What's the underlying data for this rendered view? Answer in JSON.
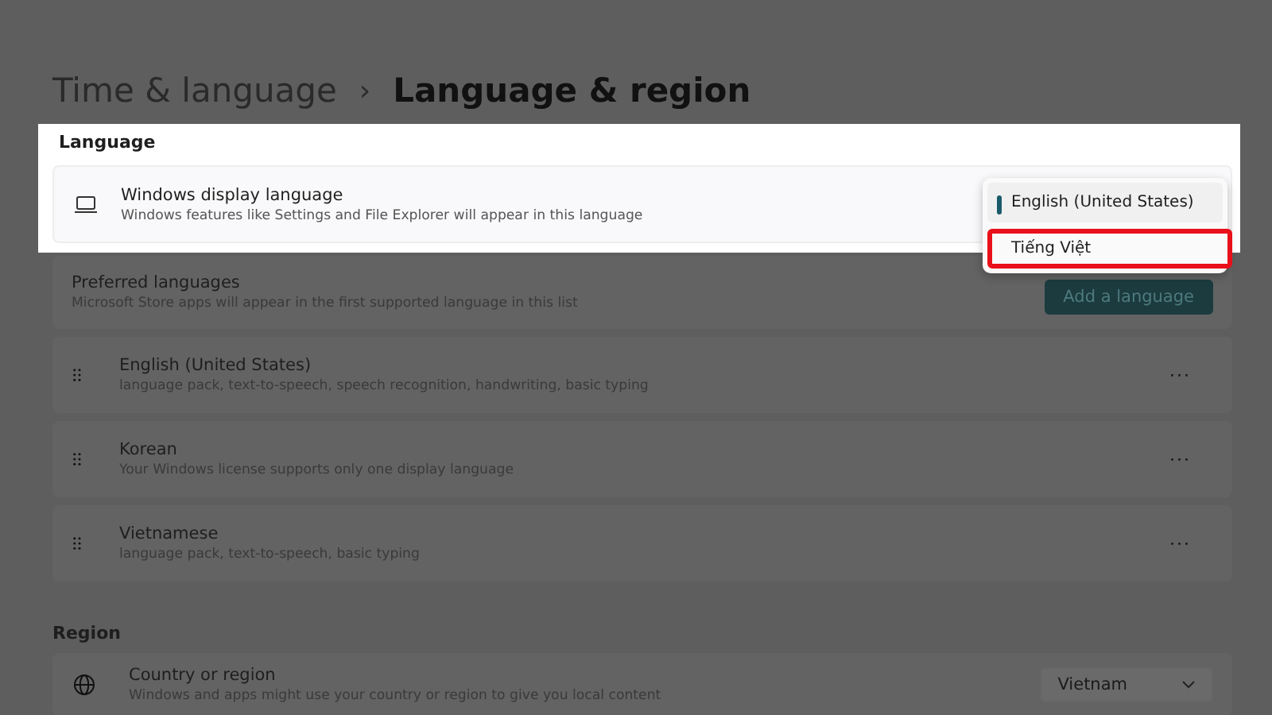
{
  "breadcrumb": {
    "parent": "Time & language",
    "separator": "›",
    "current": "Language & region"
  },
  "language_section": {
    "heading": "Language",
    "display_language": {
      "title": "Windows display language",
      "description": "Windows features like Settings and File Explorer will appear in this language"
    },
    "dropdown_options": [
      {
        "label": "English (United States)",
        "selected": true,
        "highlighted": false
      },
      {
        "label": "Tiếng Việt",
        "selected": false,
        "highlighted": true
      }
    ],
    "preferred": {
      "title": "Preferred languages",
      "description": "Microsoft Store apps will appear in the first supported language in this list",
      "button": "Add a language"
    },
    "languages": [
      {
        "name": "English (United States)",
        "description": "language pack, text-to-speech, speech recognition, handwriting, basic typing",
        "more": "···"
      },
      {
        "name": "Korean",
        "description": "Your Windows license supports only one display language",
        "more": "···"
      },
      {
        "name": "Vietnamese",
        "description": "language pack, text-to-speech, basic typing",
        "more": "···"
      }
    ]
  },
  "region_section": {
    "heading": "Region",
    "country": {
      "title": "Country or region",
      "description": "Windows and apps might use your country or region to give you local content",
      "value": "Vietnam"
    }
  }
}
